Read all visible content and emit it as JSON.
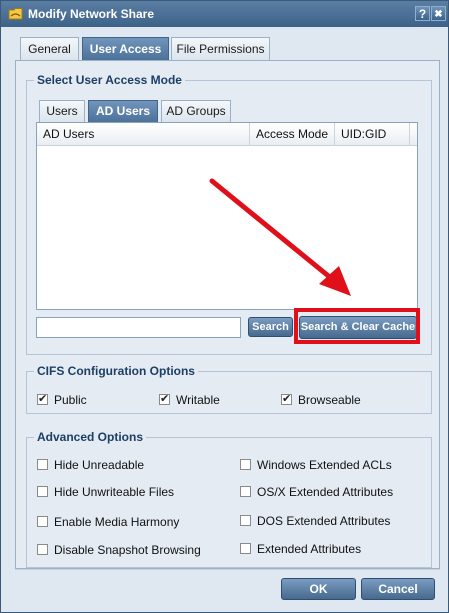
{
  "window": {
    "title": "Modify Network Share",
    "help_glyph": "?",
    "close_glyph": "✖"
  },
  "outer_tabs": [
    {
      "label": "General",
      "active": false
    },
    {
      "label": "User Access",
      "active": true
    },
    {
      "label": "File Permissions",
      "active": false
    }
  ],
  "user_access": {
    "group_title": "Select User Access Mode",
    "inner_tabs": [
      {
        "label": "Users",
        "active": false
      },
      {
        "label": "AD Users",
        "active": true
      },
      {
        "label": "AD Groups",
        "active": false
      }
    ],
    "columns": [
      "AD Users",
      "Access Mode",
      "UID:GID"
    ],
    "rows": [],
    "search": {
      "value": "",
      "placeholder": ""
    },
    "search_button": "Search",
    "search_clear_button": "Search & Clear Cache"
  },
  "cifs": {
    "group_title": "CIFS Configuration Options",
    "options": [
      {
        "label": "Public",
        "checked": true
      },
      {
        "label": "Writable",
        "checked": true
      },
      {
        "label": "Browseable",
        "checked": true
      }
    ]
  },
  "advanced": {
    "group_title": "Advanced Options",
    "options": [
      {
        "label": "Hide Unreadable",
        "checked": false
      },
      {
        "label": "Windows Extended ACLs",
        "checked": false
      },
      {
        "label": "Hide Unwriteable Files",
        "checked": false
      },
      {
        "label": "OS/X Extended Attributes",
        "checked": false
      },
      {
        "label": "Enable Media Harmony",
        "checked": false
      },
      {
        "label": "DOS Extended Attributes",
        "checked": false
      },
      {
        "label": "Disable Snapshot Browsing",
        "checked": false
      },
      {
        "label": "Extended Attributes",
        "checked": false
      }
    ]
  },
  "footer": {
    "ok": "OK",
    "cancel": "Cancel"
  },
  "colors": {
    "title_bar": "#3d6289",
    "accent_tab": "#4d729a",
    "annotation_red": "#e0101a"
  }
}
